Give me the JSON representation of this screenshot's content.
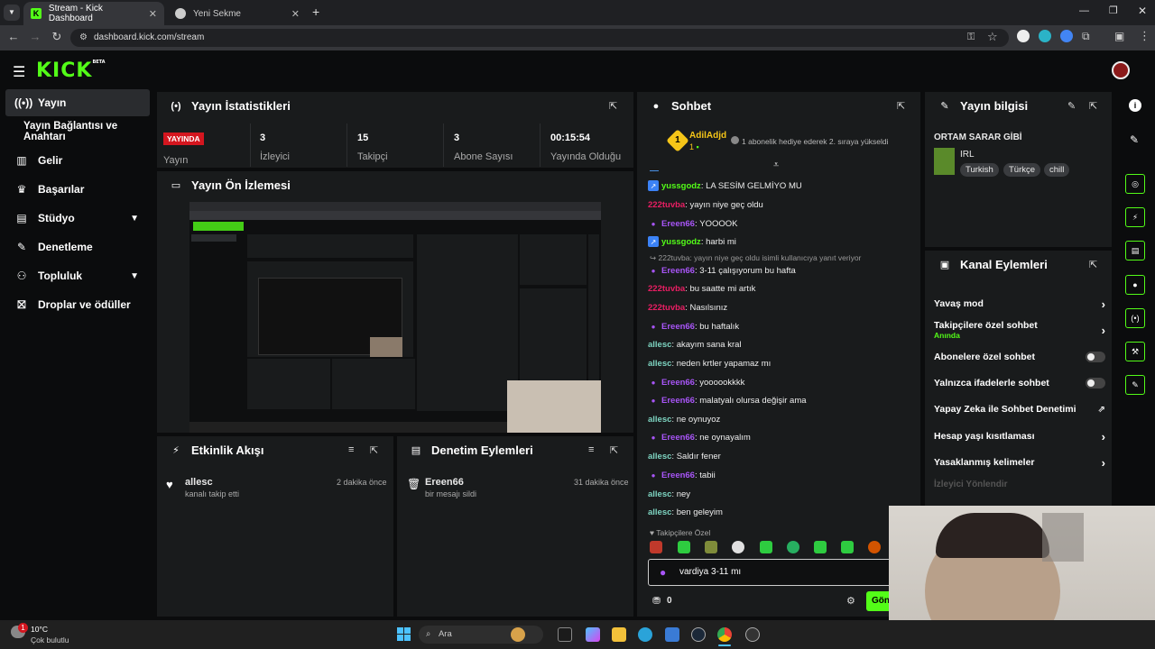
{
  "browser": {
    "tabs": [
      {
        "label": "Stream - Kick Dashboard",
        "active": true
      },
      {
        "label": "Yeni Sekme",
        "active": false
      }
    ],
    "url": "dashboard.kick.com/stream"
  },
  "kick": {
    "logo": "KICK",
    "logo_sup": "BETA",
    "accent": "#53fc18"
  },
  "sidebar": {
    "items": [
      {
        "label": "Yayın",
        "icon": "broadcast-icon",
        "active": true
      },
      {
        "label": "Yayın Bağlantısı ve Anahtarı"
      },
      {
        "label": "Gelir",
        "icon": "chart-icon"
      },
      {
        "label": "Başarılar",
        "icon": "trophy-icon"
      },
      {
        "label": "Stüdyo",
        "icon": "studio-icon",
        "expand": true
      },
      {
        "label": "Denetleme",
        "icon": "wrench-icon"
      },
      {
        "label": "Topluluk",
        "icon": "people-icon",
        "expand": true
      },
      {
        "label": "Droplar ve ödüller",
        "icon": "gift-icon"
      }
    ]
  },
  "stats": {
    "title": "Yayın İstatistikleri",
    "live_badge": "YAYINDA",
    "live_label": "Yayın",
    "items": [
      {
        "value": "3",
        "label": "İzleyici"
      },
      {
        "value": "15",
        "label": "Takipçi"
      },
      {
        "value": "3",
        "label": "Abone Sayısı"
      },
      {
        "value": "00:15:54",
        "label": "Yayında Olduğu"
      }
    ]
  },
  "preview": {
    "title": "Yayın Ön İzlemesi"
  },
  "activity": {
    "title": "Etkinlik Akışı",
    "items": [
      {
        "user": "allesc",
        "text": "kanalı takip etti",
        "time": "2 dakika önce"
      }
    ]
  },
  "moderation": {
    "title": "Denetim Eylemleri",
    "items": [
      {
        "user": "Ereen66",
        "text": "bir mesajı sildi",
        "time": "31 dakika önce"
      }
    ]
  },
  "chat": {
    "title": "Sohbet",
    "pinned_user": "AdilAdjd",
    "pinned_count": "1",
    "pinned_text": "1 abonelik hediye ederek 2. sıraya yükseldi",
    "reply_note": "222tuvba: yayın niye geç oldu isimli kullanıcıya yanıt veriyor",
    "messages": [
      {
        "user": "yussgodz",
        "text": "LA SESİM GELMİYO MU",
        "color": "#53fc18",
        "badge": "blue"
      },
      {
        "user": "222tuvba",
        "text": "yayın niye geç oldu",
        "color": "#e91e63"
      },
      {
        "user": "Ereen66",
        "text": "YOOOOK",
        "color": "#a855f7",
        "badge": "mic"
      },
      {
        "user": "yussgodz",
        "text": "harbi mi",
        "color": "#53fc18",
        "badge": "blue"
      },
      {
        "user": "Ereen66",
        "text": "3-11 çalışıyorum bu hafta",
        "color": "#a855f7",
        "badge": "mic"
      },
      {
        "user": "222tuvba",
        "text": "bu saatte mi artık",
        "color": "#e91e63"
      },
      {
        "user": "222tuvba",
        "text": "Nasılsınız",
        "color": "#e91e63"
      },
      {
        "user": "Ereen66",
        "text": "bu haftalık",
        "color": "#a855f7",
        "badge": "mic"
      },
      {
        "user": "allesc",
        "text": "akayım sana kral",
        "color": "#7dd3c0"
      },
      {
        "user": "allesc",
        "text": "neden krtler yapamaz mı",
        "color": "#7dd3c0"
      },
      {
        "user": "Ereen66",
        "text": "yoooookkkk",
        "color": "#a855f7",
        "badge": "mic"
      },
      {
        "user": "Ereen66",
        "text": "malatyalı olursa değişir ama",
        "color": "#a855f7",
        "badge": "mic"
      },
      {
        "user": "allesc",
        "text": "ne oynuyoz",
        "color": "#7dd3c0"
      },
      {
        "user": "Ereen66",
        "text": "ne oynayalım",
        "color": "#a855f7",
        "badge": "mic"
      },
      {
        "user": "allesc",
        "text": "Saldır fener",
        "color": "#7dd3c0"
      },
      {
        "user": "Ereen66",
        "text": "tabii",
        "color": "#a855f7",
        "badge": "mic"
      },
      {
        "user": "allesc",
        "text": "ney",
        "color": "#7dd3c0"
      },
      {
        "user": "allesc",
        "text": "ben geleyim",
        "color": "#7dd3c0"
      }
    ],
    "followers_only": "Takipçilere Özel",
    "input_value": "vardiya 3-11 mı",
    "points": "0",
    "send_label": "Gönder"
  },
  "stream_info": {
    "title": "Yayın bilgisi",
    "stream_title": "ORTAM SARAR GİBİ",
    "category": "IRL",
    "tags": [
      "Turkish",
      "Türkçe",
      "chill"
    ]
  },
  "channel_actions": {
    "title": "Kanal Eylemleri",
    "items": [
      {
        "label": "Yavaş mod",
        "kind": "chevron"
      },
      {
        "label": "Takipçilere özel sohbet",
        "sub": "Anında",
        "kind": "chevron"
      },
      {
        "label": "Abonelere özel sohbet",
        "kind": "toggle"
      },
      {
        "label": "Yalnızca ifadelerle sohbet",
        "kind": "toggle"
      },
      {
        "label": "Yapay Zeka ile Sohbet Denetimi",
        "kind": "external"
      },
      {
        "label": "Hesap yaşı kısıtlaması",
        "kind": "chevron"
      },
      {
        "label": "Yasaklanmış kelimeler",
        "kind": "chevron"
      }
    ],
    "faded": "İzleyici Yönlendir"
  },
  "taskbar": {
    "weather_temp": "10°C",
    "weather_text": "Çok bulutlu",
    "search": "Ara",
    "notif": "1"
  }
}
